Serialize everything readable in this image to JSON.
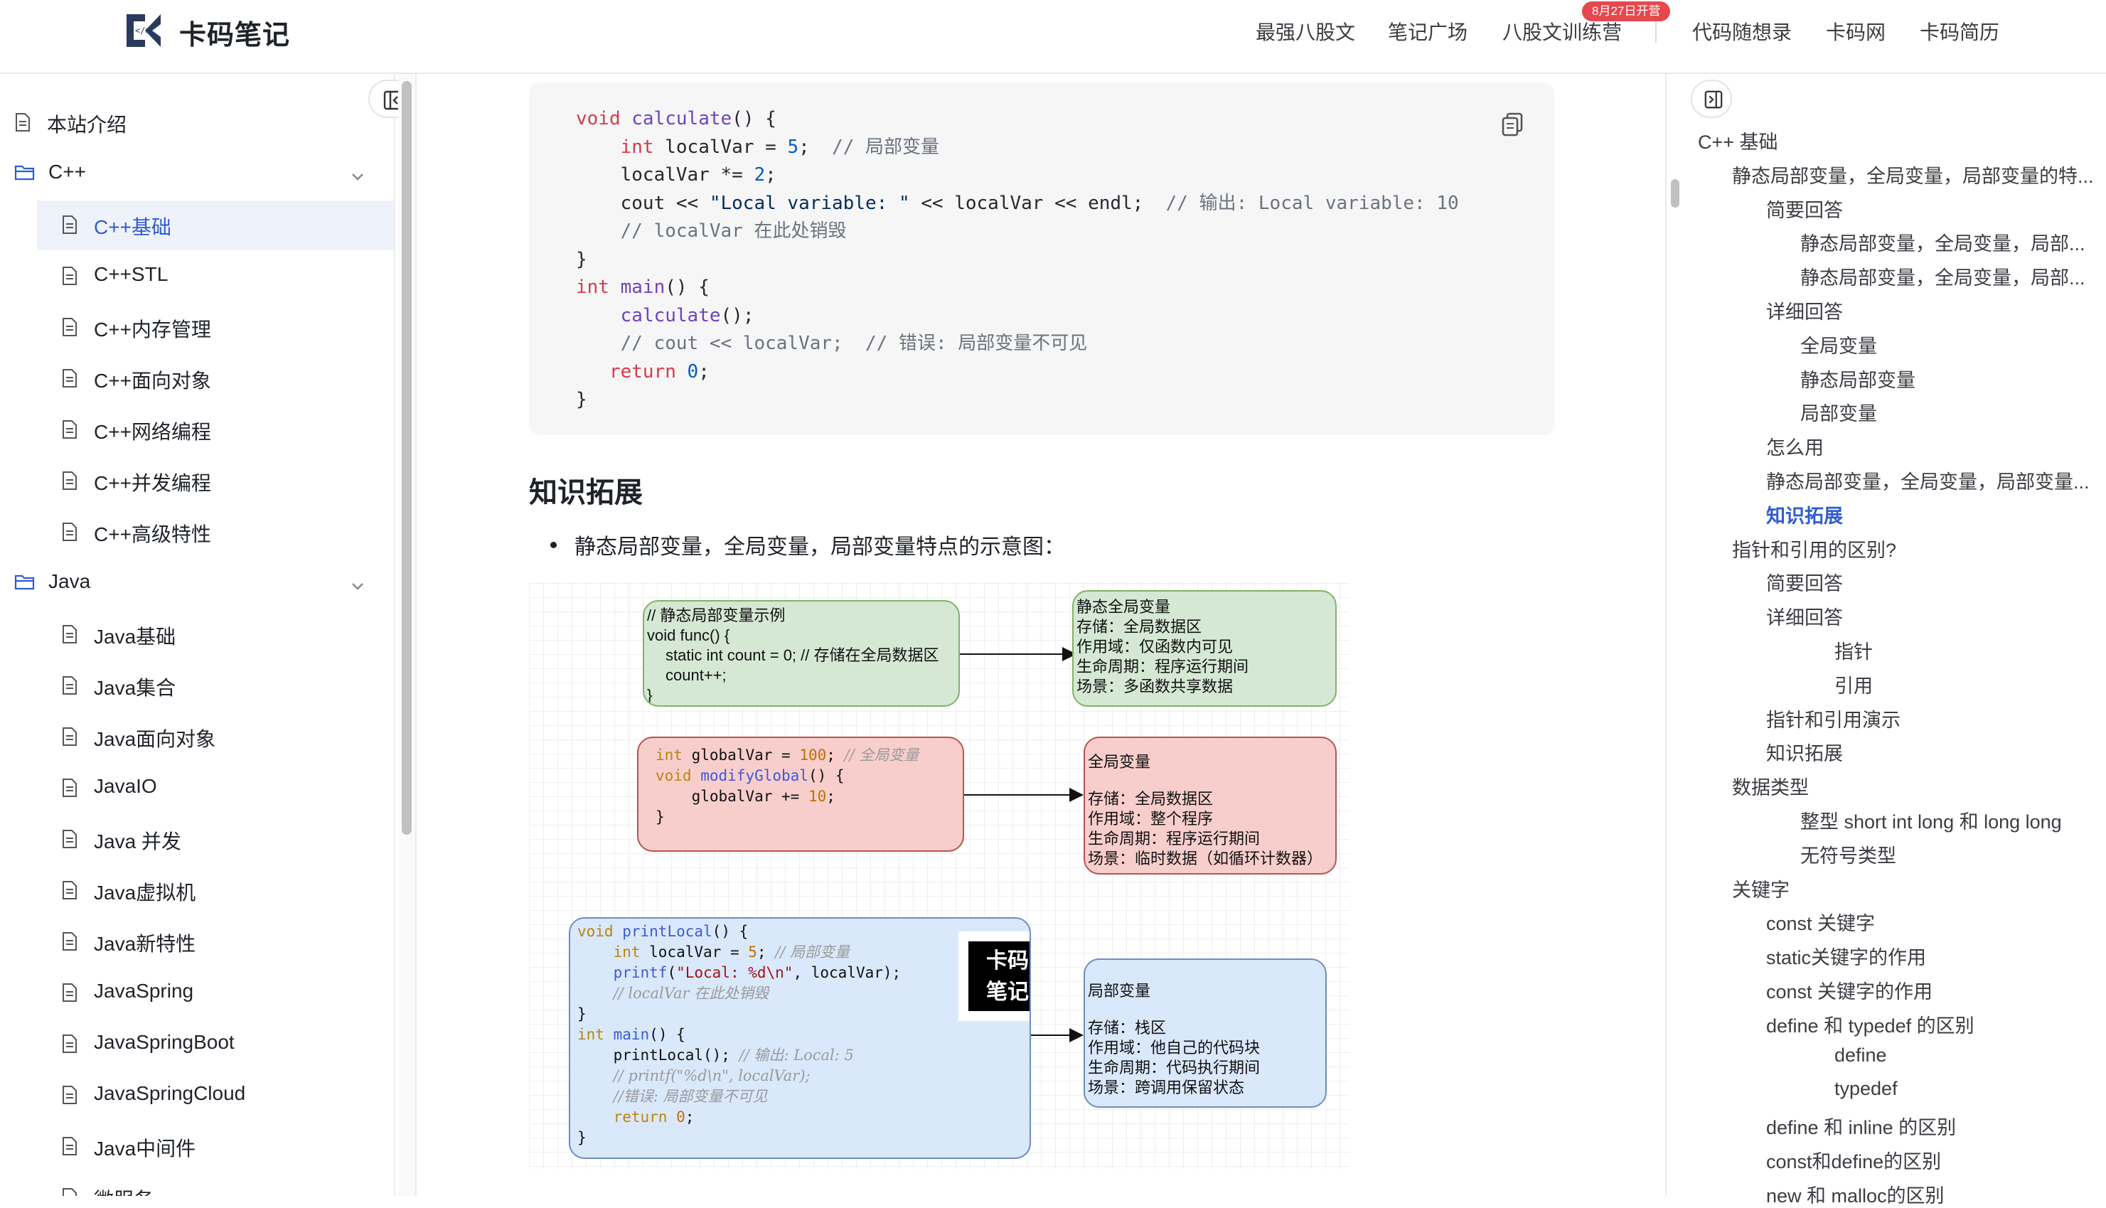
{
  "header": {
    "logo_text": "卡码笔记",
    "nav": [
      {
        "label": "最强八股文"
      },
      {
        "label": "笔记广场"
      },
      {
        "label": "八股文训练营",
        "badge": "8月27日开营"
      },
      {
        "label": "代码随想录"
      },
      {
        "label": "卡码网"
      },
      {
        "label": "卡码简历"
      }
    ]
  },
  "sidebar": {
    "items": [
      {
        "label": "本站介绍",
        "type": "page"
      },
      {
        "label": "C++",
        "type": "folder",
        "expanded": true
      },
      {
        "label": "C++基础",
        "type": "page",
        "active": true
      },
      {
        "label": "C++STL",
        "type": "page"
      },
      {
        "label": "C++内存管理",
        "type": "page"
      },
      {
        "label": "C++面向对象",
        "type": "page"
      },
      {
        "label": "C++网络编程",
        "type": "page"
      },
      {
        "label": "C++并发编程",
        "type": "page"
      },
      {
        "label": "C++高级特性",
        "type": "page"
      },
      {
        "label": "Java",
        "type": "folder",
        "expanded": true
      },
      {
        "label": "Java基础",
        "type": "page"
      },
      {
        "label": "Java集合",
        "type": "page"
      },
      {
        "label": "Java面向对象",
        "type": "page"
      },
      {
        "label": "JavaIO",
        "type": "page"
      },
      {
        "label": "Java 并发",
        "type": "page"
      },
      {
        "label": "Java虚拟机",
        "type": "page"
      },
      {
        "label": "Java新特性",
        "type": "page"
      },
      {
        "label": "JavaSpring",
        "type": "page"
      },
      {
        "label": "JavaSpringBoot",
        "type": "page"
      },
      {
        "label": "JavaSpringCloud",
        "type": "page"
      },
      {
        "label": "Java中间件",
        "type": "page"
      },
      {
        "label": "微服务",
        "type": "page"
      }
    ]
  },
  "content": {
    "code_lines": [
      "void calculate() {",
      "    int localVar = 5;  // 局部变量",
      "    localVar *= 2;",
      "    cout << \"Local variable: \" << localVar << endl;  // 输出: Local variable: 10",
      "    // localVar 在此处销毁",
      "}",
      "int main() {",
      "    calculate();",
      "    // cout << localVar;  // 错误: 局部变量不可见",
      "   return 0;",
      "}"
    ],
    "section_title": "知识拓展",
    "bullet_text": "静态局部变量，全局变量，局部变量特点的示意图："
  },
  "diagram": {
    "static_code": [
      "// 静态局部变量示例",
      "void func() {",
      "    static int count = 0; // 存储在全局数据区",
      "    count++;",
      "}"
    ],
    "static_desc": [
      "静态全局变量",
      "存储：全局数据区",
      "作用域：仅函数内可见",
      "生命周期：程序运行期间",
      "场景：多函数共享数据"
    ],
    "global_code": [
      "int globalVar = 100; // 全局变量",
      "void modifyGlobal() {",
      "    globalVar += 10;",
      "}"
    ],
    "global_desc": [
      "全局变量",
      "",
      "存储：全局数据区",
      "作用域：整个程序",
      "生命周期：程序运行期间",
      "场景：临时数据（如循环计数器）"
    ],
    "local_code": [
      "void printLocal() {",
      "    int localVar = 5; // 局部变量",
      "    printf(\"Local: %d\\n\", localVar);",
      "    // localVar 在此处销毁",
      "}",
      "int main() {",
      "    printLocal(); // 输出: Local: 5",
      "    // printf(\"%d\\n\", localVar);",
      "    //错误: 局部变量不可见",
      "    return 0;",
      "}"
    ],
    "local_desc": [
      "局部变量",
      "",
      "存储：栈区",
      "作用域：他自己的代码块",
      "生命周期：代码执行期间",
      "场景：跨调用保留状态"
    ],
    "stamp_text": [
      "卡码",
      "笔记"
    ]
  },
  "toc": {
    "items": [
      {
        "label": "C++ 基础",
        "level": 0
      },
      {
        "label": "静态局部变量，全局变量，局部变量的特...",
        "level": 1
      },
      {
        "label": "简要回答",
        "level": 2
      },
      {
        "label": "静态局部变量，全局变量，局部...",
        "level": 3
      },
      {
        "label": "静态局部变量，全局变量，局部...",
        "level": 3
      },
      {
        "label": "详细回答",
        "level": 2
      },
      {
        "label": "全局变量",
        "level": 3
      },
      {
        "label": "静态局部变量",
        "level": 3
      },
      {
        "label": "局部变量",
        "level": 3
      },
      {
        "label": "怎么用",
        "level": 2
      },
      {
        "label": "静态局部变量，全局变量，局部变量...",
        "level": 2
      },
      {
        "label": "知识拓展",
        "level": 2,
        "active": true
      },
      {
        "label": "指针和引用的区别?",
        "level": 1
      },
      {
        "label": "简要回答",
        "level": 2
      },
      {
        "label": "详细回答",
        "level": 2
      },
      {
        "label": "指针",
        "level": 4
      },
      {
        "label": "引用",
        "level": 4
      },
      {
        "label": "指针和引用演示",
        "level": 2
      },
      {
        "label": "知识拓展",
        "level": 2
      },
      {
        "label": "数据类型",
        "level": 1
      },
      {
        "label": "整型 short int long 和 long long",
        "level": 3
      },
      {
        "label": "无符号类型",
        "level": 3
      },
      {
        "label": "关键字",
        "level": 1
      },
      {
        "label": "const 关键字",
        "level": 2
      },
      {
        "label": "static关键字的作用",
        "level": 2
      },
      {
        "label": "const 关键字的作用",
        "level": 2
      },
      {
        "label": "define 和 typedef 的区别",
        "level": 2
      },
      {
        "label": "define",
        "level": 4
      },
      {
        "label": "typedef",
        "level": 4
      },
      {
        "label": "define 和 inline 的区别",
        "level": 2
      },
      {
        "label": "const和define的区别",
        "level": 2
      },
      {
        "label": "new 和 malloc的区别",
        "level": 2
      }
    ]
  },
  "colors": {
    "accent": "#2f5cd0",
    "active_bg": "#eef2fb",
    "badge": "#e5484d",
    "green_box": "#d5e8d4",
    "red_box": "#f8cecc",
    "blue_box": "#dae8fc"
  }
}
